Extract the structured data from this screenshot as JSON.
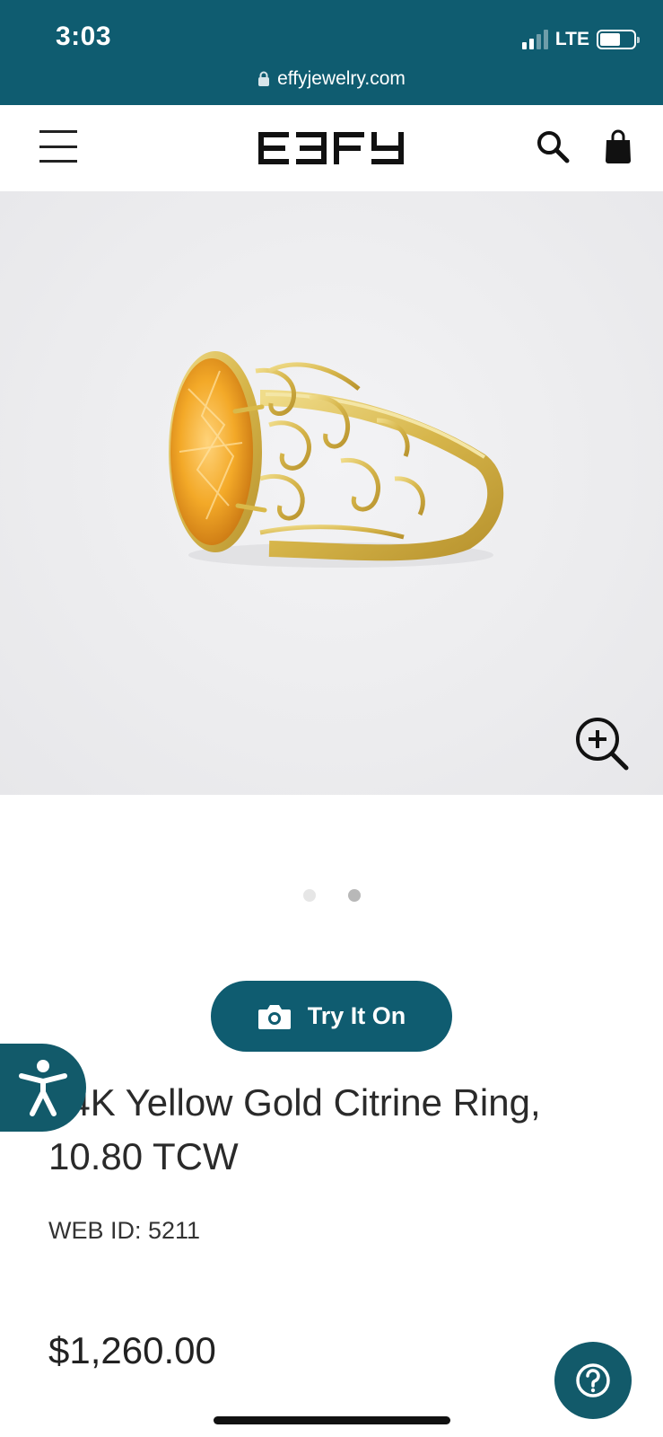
{
  "status_bar": {
    "time": "3:03",
    "network": "LTE",
    "battery_icon": "battery-icon",
    "signal_icon": "signal-icon"
  },
  "browser": {
    "url": "effyjewelry.com",
    "lock_icon": "lock-icon"
  },
  "header": {
    "logo_text": "EFFY",
    "menu_icon": "hamburger-menu-icon",
    "search_icon": "search-icon",
    "bag_icon": "shopping-bag-icon"
  },
  "gallery": {
    "zoom_icon": "zoom-in-icon",
    "slide_count": 2,
    "active_slide": 2
  },
  "try_on": {
    "label": "Try It On",
    "icon": "camera-icon"
  },
  "product": {
    "title": "14K Yellow Gold Citrine Ring, 10.80 TCW",
    "web_id": "WEB ID: 5211",
    "price": "$1,260.00"
  },
  "accessibility": {
    "icon": "accessibility-icon"
  },
  "help": {
    "icon": "help-question-icon"
  },
  "colors": {
    "brand_teal": "#0f5c70",
    "button_teal": "#125a6a",
    "gold": "#d9b94a",
    "citrine": "#f0a12a"
  }
}
